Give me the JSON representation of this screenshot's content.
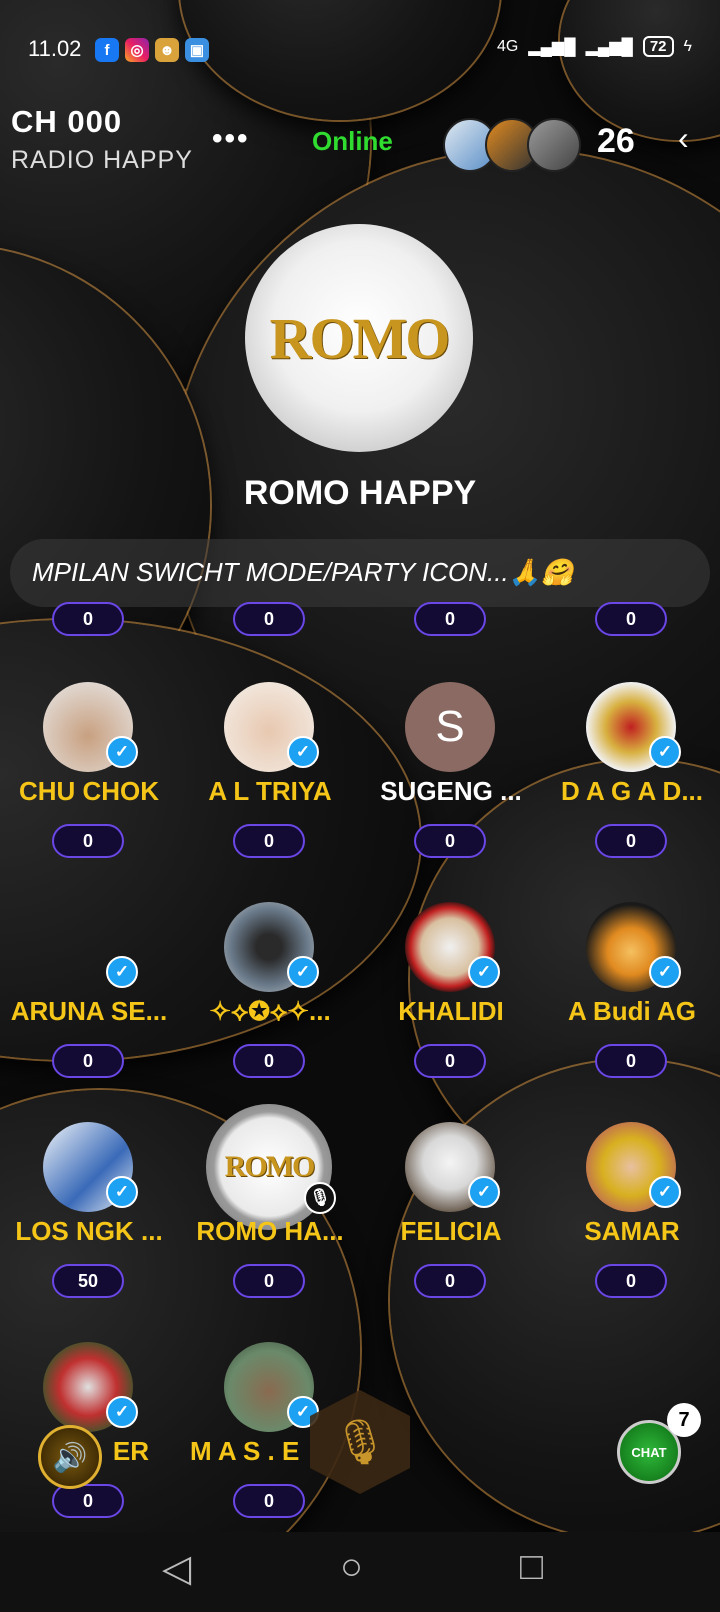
{
  "status_bar": {
    "time": "11.02",
    "network": "4G",
    "battery": "72",
    "app_icons": [
      "facebook-icon",
      "instagram-icon",
      "game-icon",
      "app-icon"
    ]
  },
  "header": {
    "channel": "CH 000",
    "name": "RADIO HAPPY",
    "more": "•••",
    "online_label": "Online",
    "listener_count": "26",
    "back": "‹"
  },
  "host": {
    "logo_text": "ROMO",
    "name": "ROMO HAPPY"
  },
  "marquee": {
    "text": "MPILAN SWICHT MODE/PARTY ICON...🙏🤗"
  },
  "top_row_scores": [
    "0",
    "0",
    "0",
    "0"
  ],
  "seats": [
    {
      "name": "CHU CHOK",
      "score": "0",
      "avatar": "photo",
      "verified": true
    },
    {
      "name": "A  L TRIYA",
      "score": "0",
      "avatar": "photo",
      "verified": true
    },
    {
      "name": "SUGENG ...",
      "score": "0",
      "avatar": "letter",
      "letter": "S",
      "verified": false
    },
    {
      "name": "D A G A D...",
      "score": "0",
      "avatar": "photo",
      "verified": true
    },
    {
      "name": "ARUNA SE...",
      "score": "0",
      "avatar": "none",
      "verified": true
    },
    {
      "name": "✧⟡✪⟡✧...",
      "score": "0",
      "avatar": "photo",
      "verified": true
    },
    {
      "name": "KHALIDI",
      "score": "0",
      "avatar": "photo",
      "verified": true
    },
    {
      "name": "A Budi AG",
      "score": "0",
      "avatar": "photo",
      "verified": true
    },
    {
      "name": "LOS NGK ...",
      "score": "50",
      "avatar": "photo",
      "verified": true
    },
    {
      "name": "ROMO HA...",
      "score": "0",
      "avatar": "logo",
      "verified": false
    },
    {
      "name": "FELICIA",
      "score": "0",
      "avatar": "photo",
      "verified": true
    },
    {
      "name": "SAMAR",
      "score": "0",
      "avatar": "photo",
      "verified": true
    },
    {
      "name": "ER",
      "score": "0",
      "avatar": "photo",
      "verified": true
    },
    {
      "name": "M A S . E",
      "score": "0",
      "avatar": "photo",
      "verified": true
    }
  ],
  "chat": {
    "label": "CHAT",
    "unread": "7"
  },
  "colors": {
    "accent_gold": "#f5c518",
    "online_green": "#2fdc2f",
    "pill_border": "#6a47e6"
  }
}
